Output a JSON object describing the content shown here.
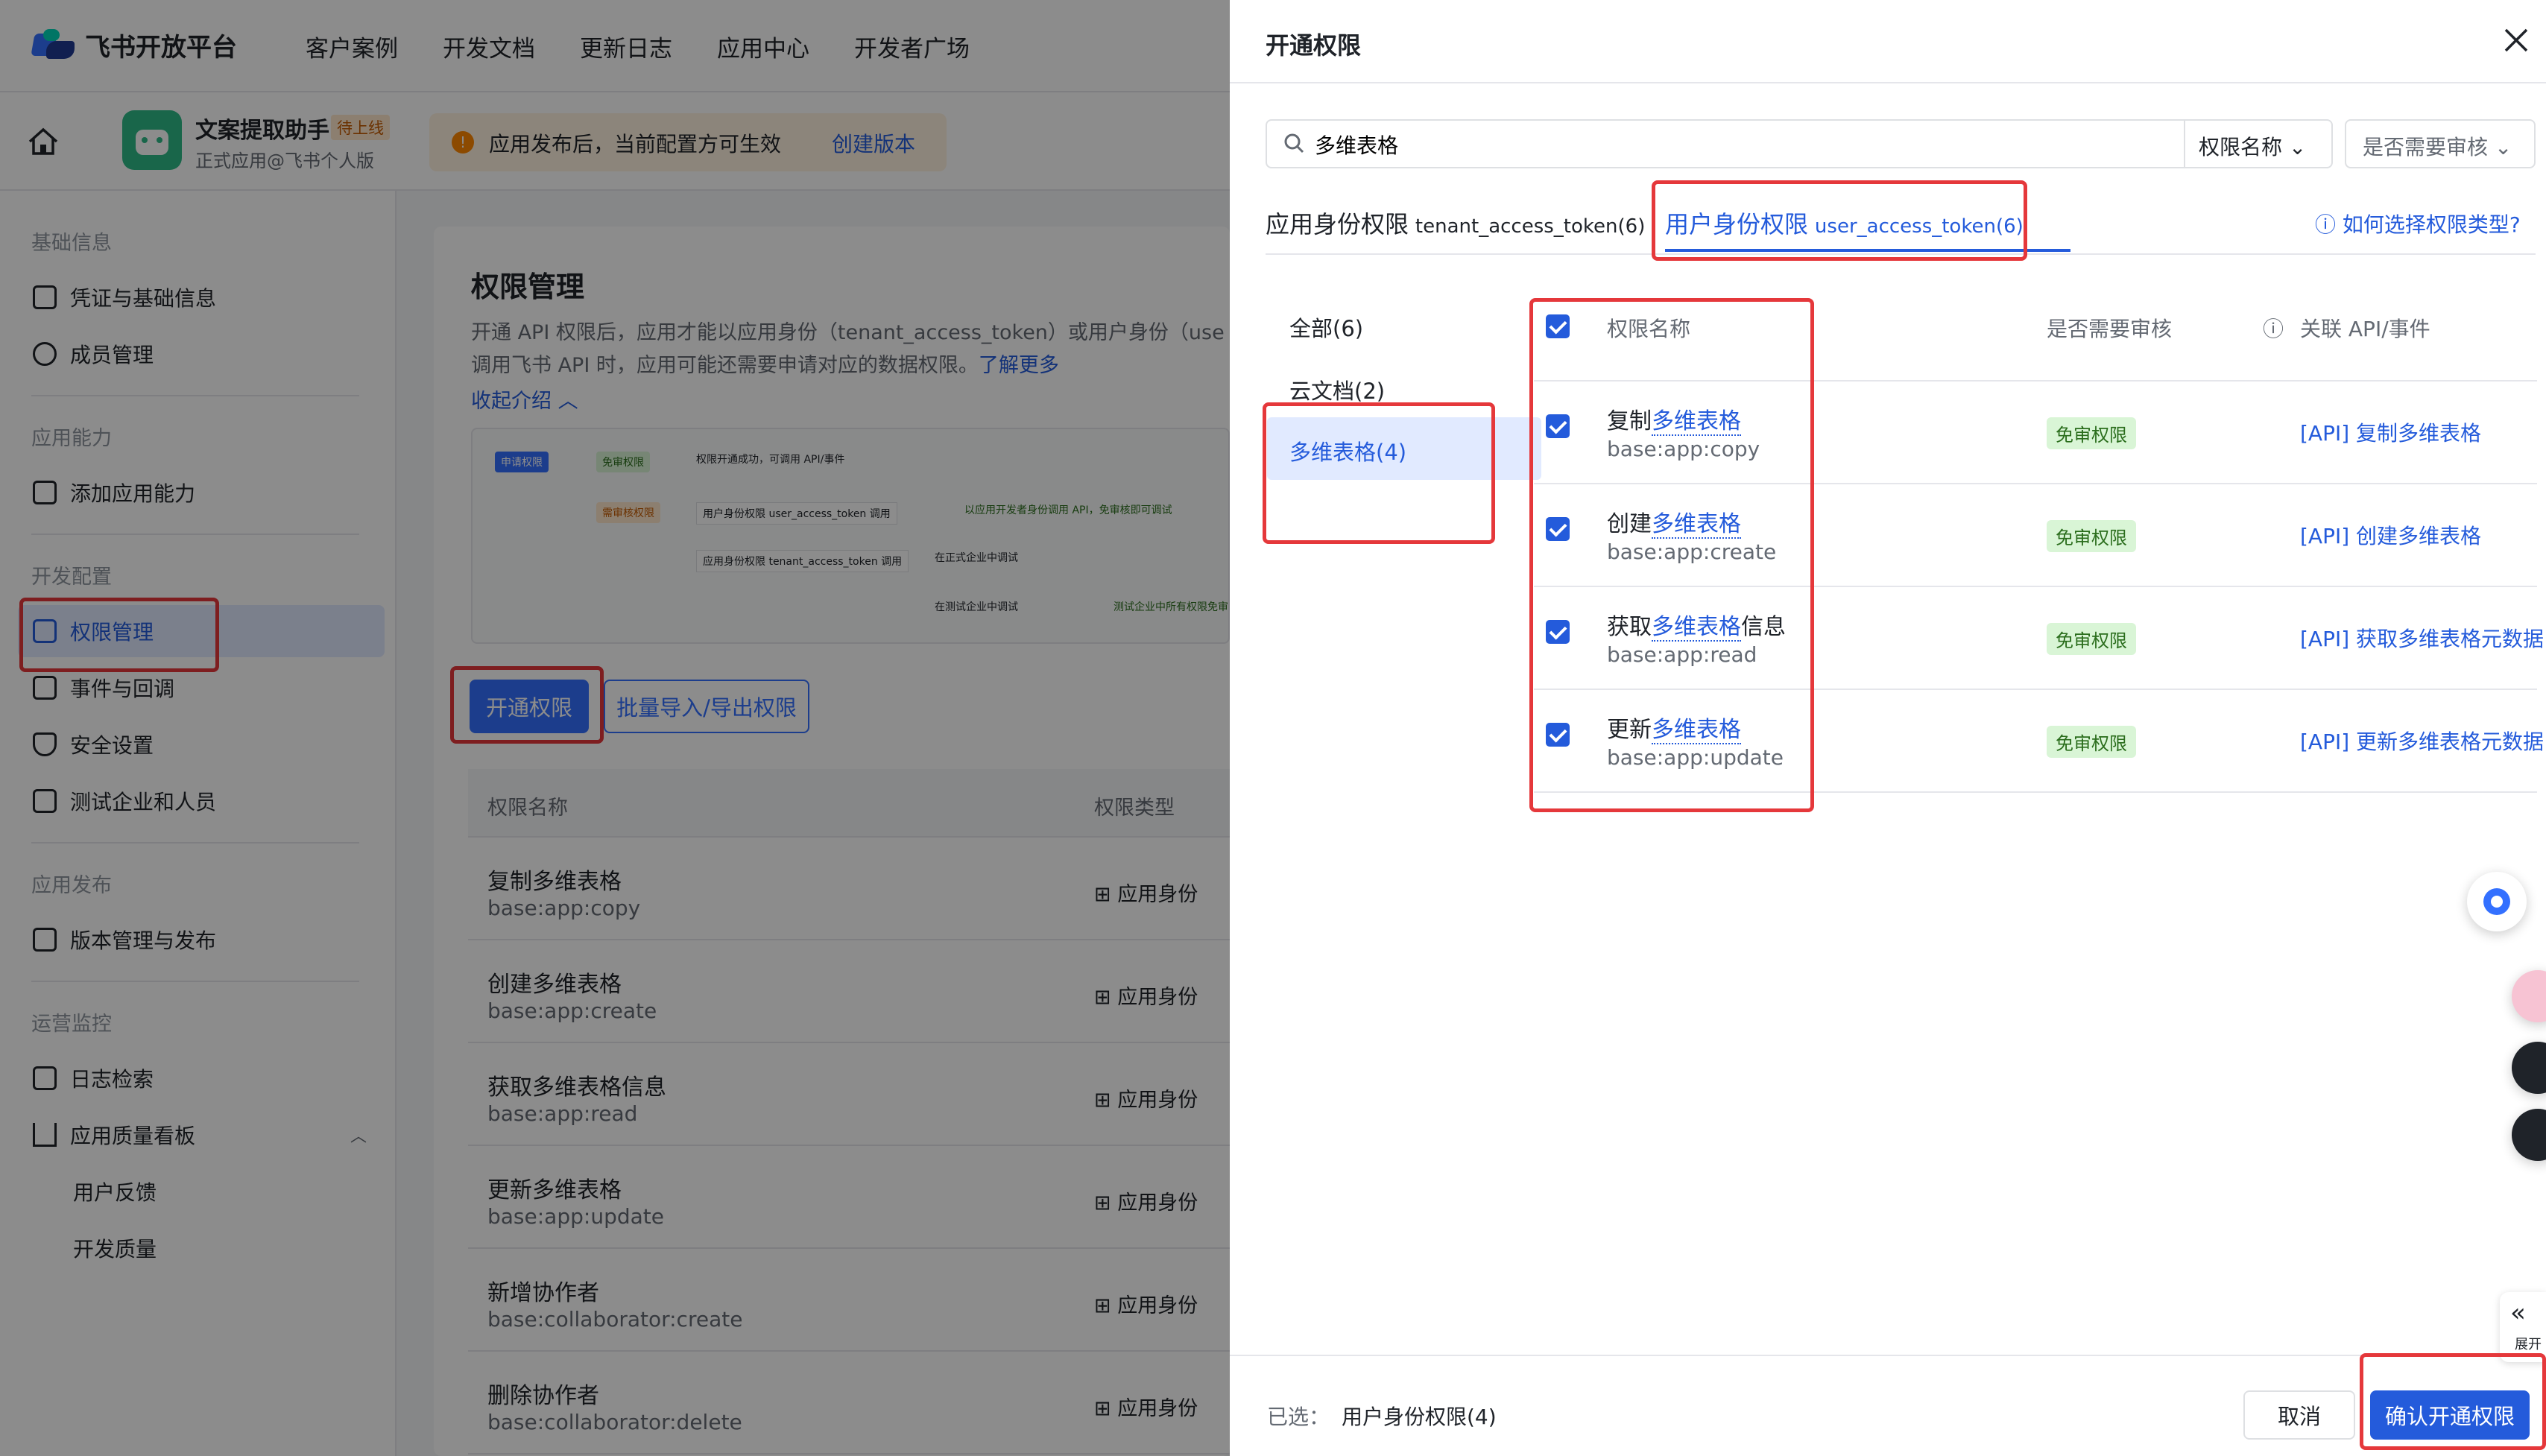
{
  "topbar": {
    "logo": "飞书开放平台",
    "nav": [
      "客户案例",
      "开发文档",
      "更新日志",
      "应用中心",
      "开发者广场"
    ]
  },
  "appbar": {
    "app_name": "文案提取助手",
    "status": "待上线",
    "subtitle": "正式应用@飞书个人版",
    "notice": "应用发布后，当前配置方可生效",
    "create_version": "创建版本"
  },
  "sidebar": {
    "groups": [
      "基础信息",
      "应用能力",
      "开发配置",
      "应用发布",
      "运营监控"
    ],
    "items": [
      "凭证与基础信息",
      "成员管理",
      "添加应用能力",
      "权限管理",
      "事件与回调",
      "安全设置",
      "测试企业和人员",
      "版本管理与发布",
      "日志检索",
      "应用质量看板",
      "用户反馈",
      "开发质量"
    ]
  },
  "main": {
    "title": "权限管理",
    "desc1": "开通 API 权限后，应用才能以应用身份（tenant_access_token）或用户身份（use",
    "desc2": "调用飞书 API 时，应用可能还需要申请对应的数据权限。",
    "learn_more": "了解更多",
    "collapse": "收起介绍",
    "flow": [
      "申请权限",
      "免审权限",
      "权限开通成功，可调用 API/事件",
      "需审核权限",
      "用户身份权限 user_access_token 调用",
      "以应用开发者身份调用 API，免审核即可调试",
      "应用身份权限 tenant_access_token 调用",
      "在正式企业中调试",
      "在测试企业中调试",
      "测试企业中所有权限免审"
    ],
    "open_btn": "开通权限",
    "batch_btn": "批量导入/导出权限",
    "col_name": "权限名称",
    "col_type": "权限类型",
    "rows": [
      {
        "name": "复制多维表格",
        "code": "base:app:copy",
        "type": "应用身份"
      },
      {
        "name": "创建多维表格",
        "code": "base:app:create",
        "type": "应用身份"
      },
      {
        "name": "获取多维表格信息",
        "code": "base:app:read",
        "type": "应用身份"
      },
      {
        "name": "更新多维表格",
        "code": "base:app:update",
        "type": "应用身份"
      },
      {
        "name": "新增协作者",
        "code": "base:collaborator:create",
        "type": "应用身份"
      },
      {
        "name": "删除协作者",
        "code": "base:collaborator:delete",
        "type": "应用身份"
      }
    ]
  },
  "drawer": {
    "title": "开通权限",
    "search_value": "多维表格",
    "filter1": "权限名称",
    "filter2": "是否需要审核",
    "tab1_label": "应用身份权限",
    "tab1_token": "tenant_access_token(6)",
    "tab2_label": "用户身份权限",
    "tab2_token": "user_access_token(6)",
    "help": "如何选择权限类型?",
    "cats": [
      "全部(6)",
      "云文档(2)",
      "多维表格(4)"
    ],
    "col_name": "权限名称",
    "col_review": "是否需要审核",
    "col_api": "关联 API/事件",
    "perms": [
      {
        "prefix": "复制",
        "hl": "多维表格",
        "suffix": "",
        "code": "base:app:copy",
        "tag": "免审权限",
        "api": "[API] 复制多维表格"
      },
      {
        "prefix": "创建",
        "hl": "多维表格",
        "suffix": "",
        "code": "base:app:create",
        "tag": "免审权限",
        "api": "[API] 创建多维表格"
      },
      {
        "prefix": "获取",
        "hl": "多维表格",
        "suffix": "信息",
        "code": "base:app:read",
        "tag": "免审权限",
        "api": "[API] 获取多维表格元数据"
      },
      {
        "prefix": "更新",
        "hl": "多维表格",
        "suffix": "",
        "code": "base:app:update",
        "tag": "免审权限",
        "api": "[API] 更新多维表格元数据"
      }
    ],
    "selected_label": "已选：",
    "selected_value": "用户身份权限(4)",
    "cancel": "取消",
    "confirm": "确认开通权限",
    "side_label": "展开"
  }
}
